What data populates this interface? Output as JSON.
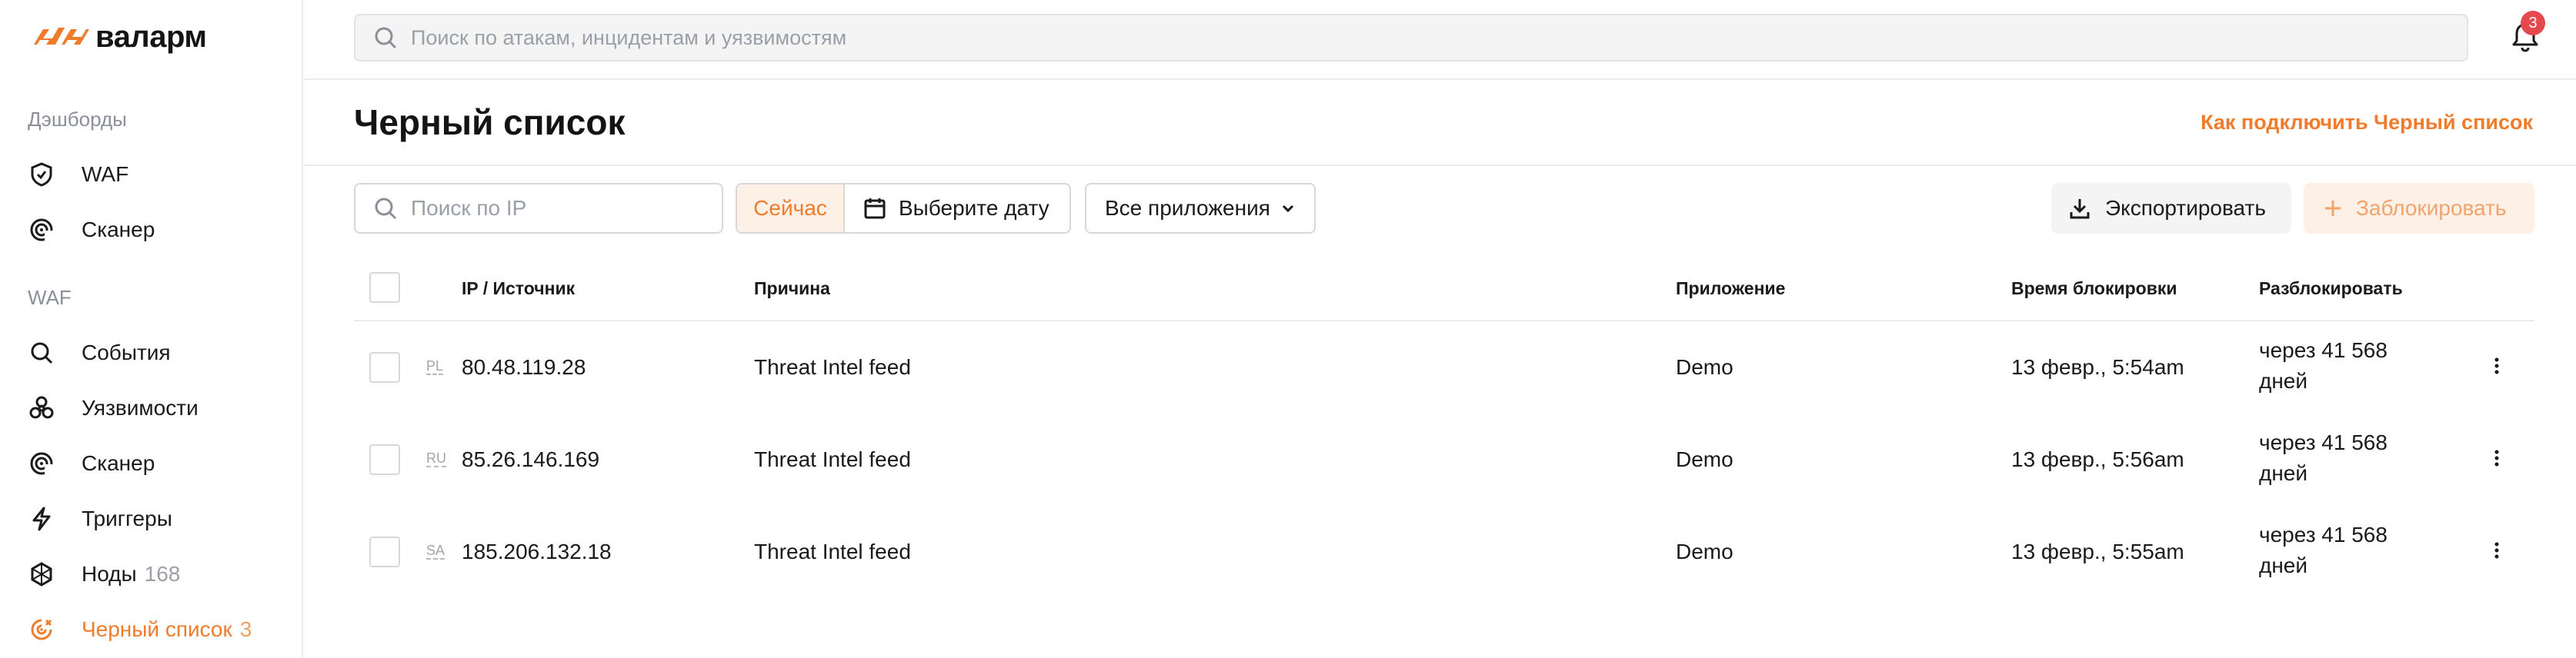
{
  "brand": {
    "name": "валарм",
    "accent": "#f07c2b"
  },
  "sidebar": {
    "sections": [
      {
        "title": "Дэшборды",
        "items": [
          {
            "label": "WAF",
            "icon": "shield-icon",
            "count": ""
          },
          {
            "label": "Сканер",
            "icon": "radar-icon",
            "count": ""
          }
        ]
      },
      {
        "title": "WAF",
        "items": [
          {
            "label": "События",
            "icon": "search-icon",
            "count": ""
          },
          {
            "label": "Уязвимости",
            "icon": "biohazard-icon",
            "count": ""
          },
          {
            "label": "Сканер",
            "icon": "radar-icon",
            "count": ""
          },
          {
            "label": "Триггеры",
            "icon": "lightning-icon",
            "count": ""
          },
          {
            "label": "Ноды",
            "icon": "nodes-icon",
            "count": "168"
          },
          {
            "label": "Черный список",
            "icon": "blacklist-icon",
            "count": "3",
            "active": true
          }
        ]
      }
    ]
  },
  "topbar": {
    "search_placeholder": "Поиск по атакам, инцидентам и уязвимостям",
    "notifications_count": "3"
  },
  "page": {
    "title": "Черный список",
    "help_link": "Как подключить Черный список"
  },
  "toolbar": {
    "ip_search_placeholder": "Поиск по IP",
    "now_label": "Сейчас",
    "date_label": "Выберите дату",
    "apps_label": "Все приложения",
    "export_label": "Экспортировать",
    "block_label": "Заблокировать"
  },
  "table": {
    "columns": [
      "IP / Источник",
      "Причина",
      "Приложение",
      "Время блокировки",
      "Разблокировать"
    ],
    "rows": [
      {
        "country": "PL",
        "ip": "80.48.119.28",
        "reason": "Threat Intel feed",
        "app": "Demo",
        "time": "13 февр., 5:54am",
        "unblock": "через 41 568 дней"
      },
      {
        "country": "RU",
        "ip": "85.26.146.169",
        "reason": "Threat Intel feed",
        "app": "Demo",
        "time": "13 февр., 5:56am",
        "unblock": "через 41 568 дней"
      },
      {
        "country": "SA",
        "ip": "185.206.132.18",
        "reason": "Threat Intel feed",
        "app": "Demo",
        "time": "13 февр., 5:55am",
        "unblock": "через 41 568 дней"
      }
    ]
  }
}
